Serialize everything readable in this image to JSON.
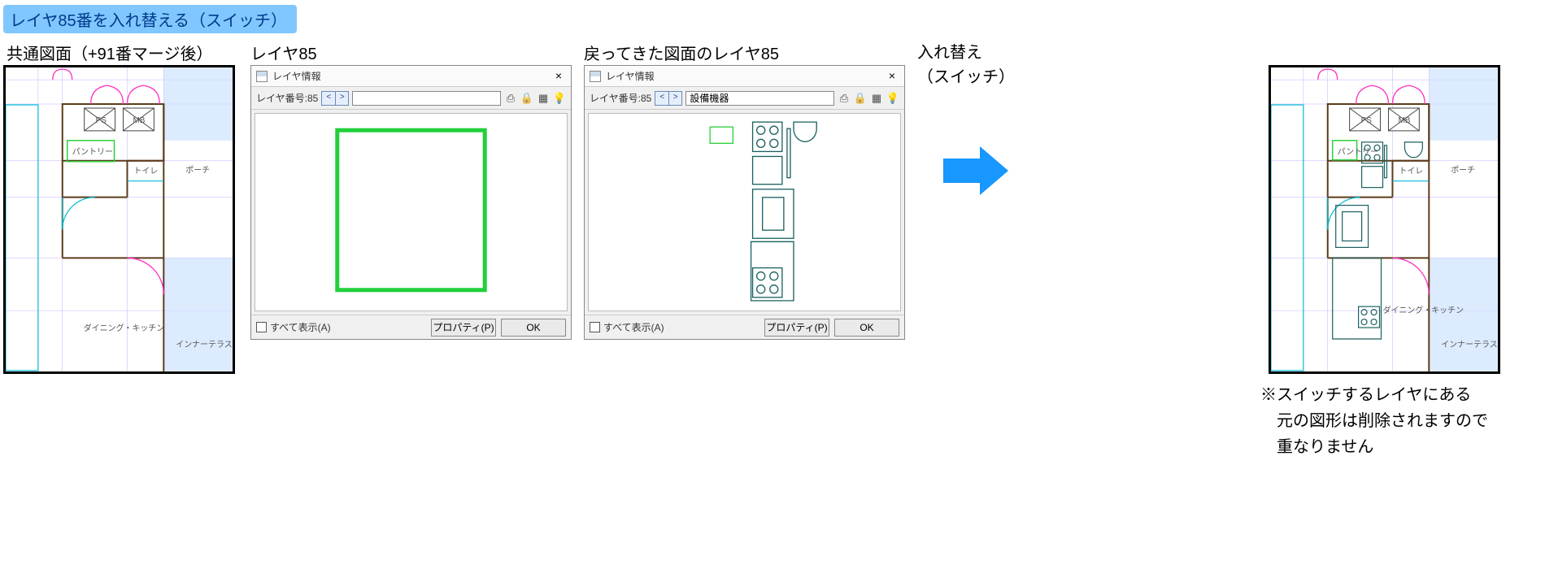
{
  "title": "レイヤ85番を入れ替える（スイッチ）",
  "captions": {
    "base_plan": "共通図面（+91番マージ後）",
    "layer85": "レイヤ85",
    "returned_layer85": "戻ってきた図面のレイヤ85",
    "switch": "入れ替え\n（スイッチ）",
    "note_l1": "※スイッチするレイヤにある",
    "note_l2": "　元の図形は削除されますので",
    "note_l3": "　重なりません"
  },
  "dialog": {
    "title": "レイヤ情報",
    "close_glyph": "×",
    "layer_no_label": "レイヤ番号:85",
    "stepper_prev": "<",
    "stepper_next": ">",
    "a": {
      "layer_name": ""
    },
    "b": {
      "layer_name": "設備機器"
    },
    "icons": {
      "printer": "printer-icon",
      "lock": "lock-icon",
      "group": "group-icon",
      "bulb": "lightbulb-icon"
    },
    "footer": {
      "show_all": "すべて表示(A)",
      "properties": "プロパティ(P)",
      "ok": "OK"
    }
  },
  "plan_labels": {
    "ps": "PS",
    "mb": "MB",
    "pantry": "パントリー",
    "toilet": "トイレ",
    "porch": "ポーチ",
    "dk": "ダイニング・\nキッチン",
    "inner": "インナーテラス"
  }
}
